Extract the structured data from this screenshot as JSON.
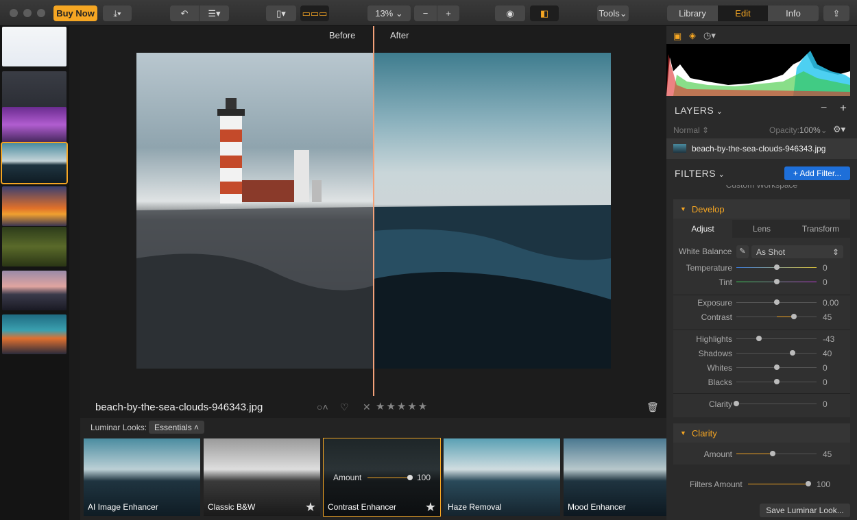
{
  "toolbar": {
    "buy_now": "Buy Now",
    "zoom": "13%",
    "tools": "Tools",
    "tabs": [
      "Library",
      "Edit",
      "Info"
    ],
    "active_tab": "Edit"
  },
  "canvas": {
    "before_label": "Before",
    "after_label": "After",
    "filename": "beach-by-the-sea-clouds-946343.jpg",
    "rating_stars": "★★★★★"
  },
  "looks": {
    "label": "Luminar Looks:",
    "category": "Essentials",
    "items": [
      {
        "name": "AI Image Enhancer"
      },
      {
        "name": "Classic B&W"
      },
      {
        "name": "Contrast Enhancer",
        "amount_label": "Amount",
        "amount_value": "100"
      },
      {
        "name": "Haze Removal"
      },
      {
        "name": "Mood Enhancer"
      }
    ]
  },
  "layers": {
    "title": "LAYERS",
    "blend_mode": "Normal",
    "opacity_label": "Opacity:",
    "opacity_value": "100%",
    "layer_name": "beach-by-the-sea-clouds-946343.jpg"
  },
  "filters": {
    "title": "FILTERS",
    "add_button": "+ Add Filter...",
    "workspace_hint": "Custom Workspace",
    "develop": {
      "title": "Develop",
      "tabs": [
        "Adjust",
        "Lens",
        "Transform"
      ],
      "white_balance_label": "White Balance",
      "white_balance_value": "As Shot",
      "sliders": [
        {
          "label": "Temperature",
          "value": "0",
          "pos": 0.5
        },
        {
          "label": "Tint",
          "value": "0",
          "pos": 0.5
        },
        {
          "label": "Exposure",
          "value": "0.00",
          "pos": 0.5
        },
        {
          "label": "Contrast",
          "value": "45",
          "pos": 0.72
        },
        {
          "label": "Highlights",
          "value": "-43",
          "pos": 0.28
        },
        {
          "label": "Shadows",
          "value": "40",
          "pos": 0.7
        },
        {
          "label": "Whites",
          "value": "0",
          "pos": 0.5
        },
        {
          "label": "Blacks",
          "value": "0",
          "pos": 0.5
        },
        {
          "label": "Clarity",
          "value": "0",
          "pos": 0.0
        }
      ]
    },
    "clarity": {
      "title": "Clarity",
      "amount_label": "Amount",
      "amount_value": "45",
      "amount_pos": 0.45
    },
    "filters_amount_label": "Filters Amount",
    "filters_amount_value": "100",
    "save_button": "Save Luminar Look..."
  }
}
